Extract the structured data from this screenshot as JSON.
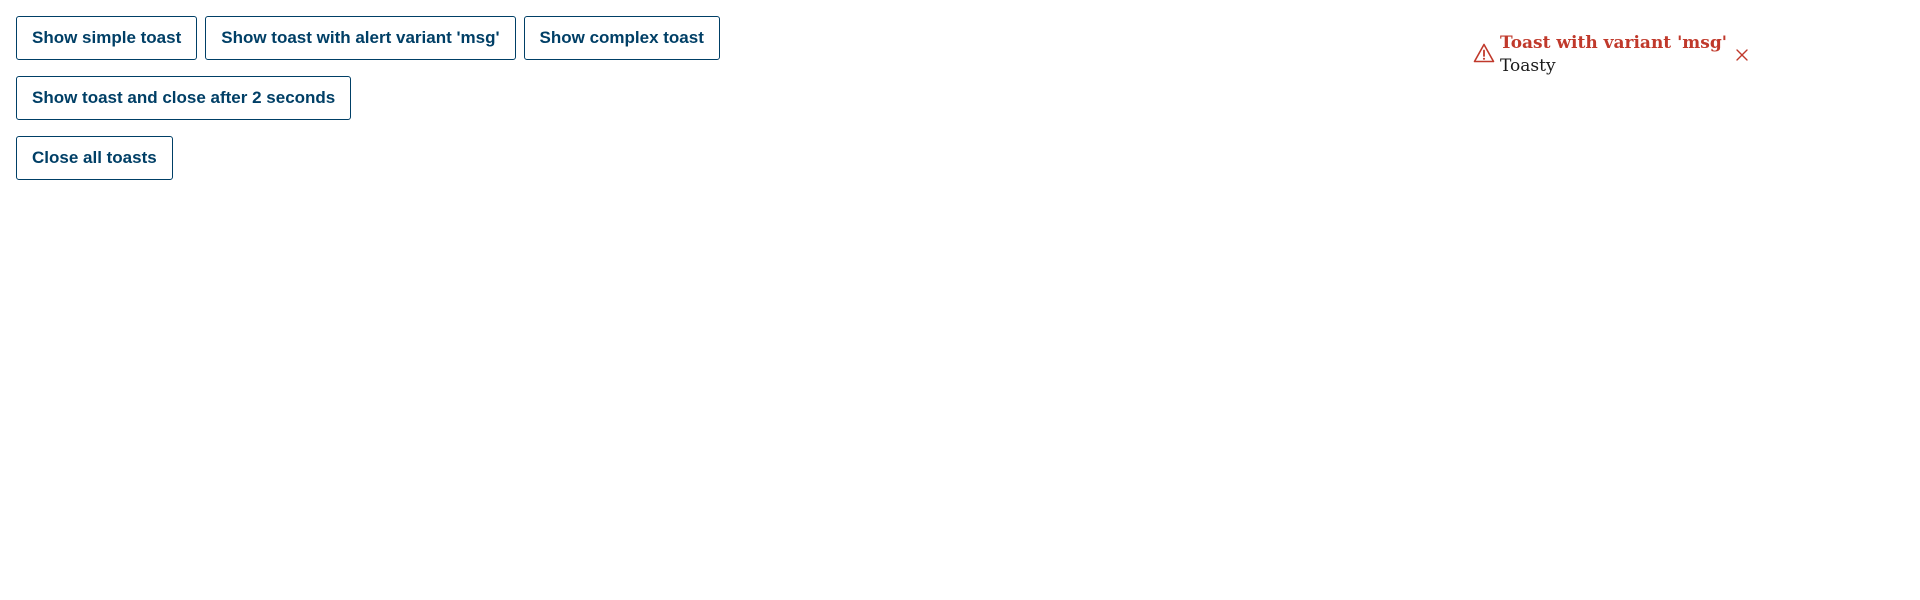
{
  "buttons": {
    "simple_toast": "Show simple toast",
    "alert_variant_toast": "Show toast with alert variant 'msg'",
    "complex_toast": "Show complex toast",
    "timed_toast": "Show toast and close after 2 seconds",
    "close_all": "Close all toasts"
  },
  "toast": {
    "title": "Toast with variant 'msg'",
    "body": "Toasty",
    "icon": "warning-icon",
    "close_icon": "close-icon"
  },
  "colors": {
    "button_text": "#003f66",
    "button_border": "#003f66",
    "toast_accent": "#c0392b",
    "toast_body": "#1a1a1a"
  }
}
